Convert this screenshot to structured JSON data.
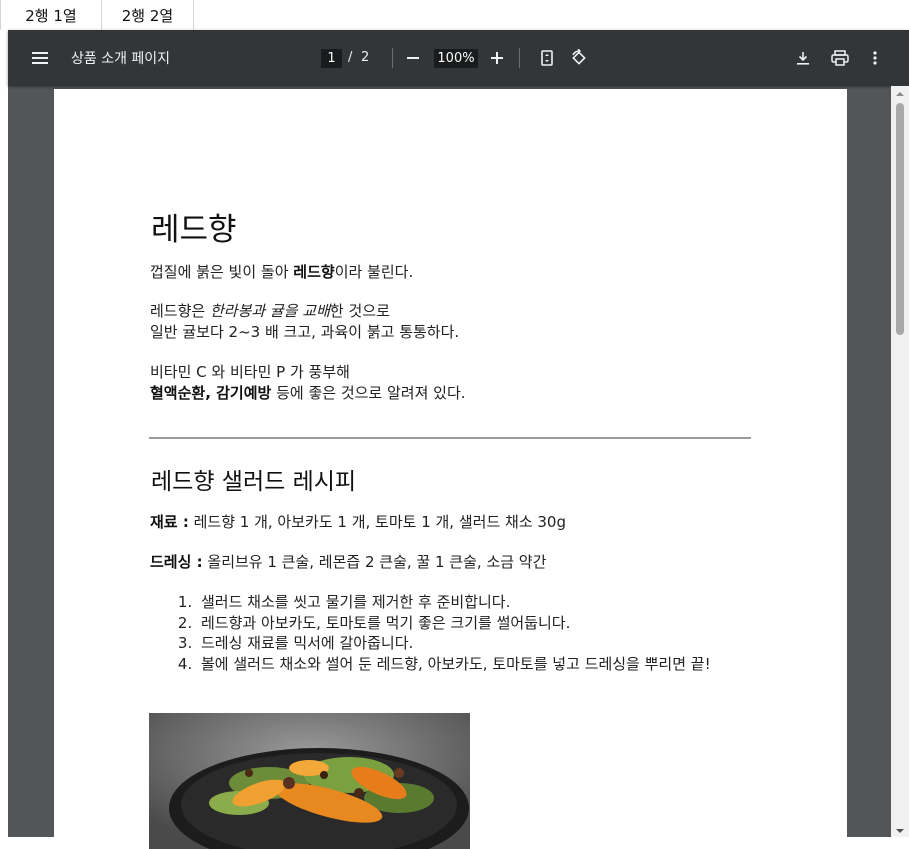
{
  "tabs": [
    {
      "label": "2행 1열"
    },
    {
      "label": "2행 2열"
    }
  ],
  "toolbar": {
    "title": "상품 소개 페이지",
    "current_page": "1",
    "page_separator": "/",
    "total_pages": "2",
    "zoom": "100%",
    "icons": [
      "menu-icon",
      "minus-icon",
      "plus-icon",
      "fit-page-icon",
      "rotate-icon",
      "download-icon",
      "print-icon",
      "more-icon"
    ]
  },
  "document": {
    "heading": "레드향",
    "intro_before": "껍질에 붉은 빛이 돌아 ",
    "intro_bold": "레드향",
    "intro_after": "이라 불린다.",
    "para2_line1_before": "레드향은 ",
    "para2_line1_italic": "한라봉과 귤을 교배",
    "para2_line1_after": "한 것으로",
    "para2_line2": "일반 귤보다 2~3 배 크고, 과육이 붉고 통통하다.",
    "para3_line1": "비타민 C 와 비타민 P 가 풍부해",
    "para3_line2_bold": "혈액순환, 감기예방",
    "para3_line2_after": " 등에 좋은 것으로 알려져 있다.",
    "recipe_heading": "레드향 샐러드 레시피",
    "ingredients_label": "재료 :",
    "ingredients_text": " 레드향 1 개, 아보카도 1 개, 토마토 1 개, 샐러드 채소 30g",
    "dressing_label": "드레싱 :",
    "dressing_text": " 올리브유 1 큰술, 레몬즙 2 큰술, 꿀 1 큰술, 소금 약간",
    "steps": [
      "샐러드 채소를 씻고 물기를 제거한 후 준비합니다.",
      "레드향과 아보카도, 토마토를 먹기 좋은 크기를 썰어둡니다.",
      "드레싱 재료를 믹서에 갈아줍니다.",
      "볼에 샐러드 채소와 썰어 둔 레드향, 아보카도, 토마토를 넣고 드레싱을 뿌리면 끝!"
    ]
  },
  "colors": {
    "toolbar_bg": "#323639",
    "viewer_bg": "#525659",
    "page_bg": "#ffffff"
  }
}
